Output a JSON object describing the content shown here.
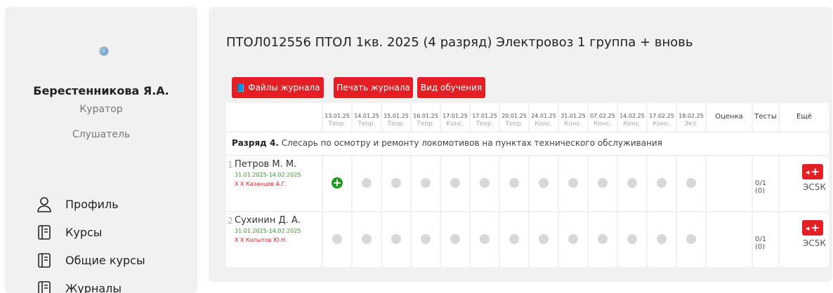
{
  "sidebar": {
    "user_name": "Берестенникова Я.А.",
    "roles": [
      "Куратор",
      "Слушатель"
    ],
    "nav": [
      {
        "label": "Профиль",
        "icon": "user-icon"
      },
      {
        "label": "Курсы",
        "icon": "book-icon"
      },
      {
        "label": "Общие курсы",
        "icon": "book-icon"
      },
      {
        "label": "Журналы",
        "icon": "book-icon"
      }
    ]
  },
  "main": {
    "title": "ПТОЛ012556  ПТОЛ 1кв. 2025 (4 разряд) Электровоз 1 группа + вновь",
    "buttons": {
      "files": "Файлы журнала",
      "print": "Печать журнала",
      "training_type": "Вид обучения"
    }
  },
  "table": {
    "columns": [
      {
        "date": "13.01.25",
        "type": "Теор."
      },
      {
        "date": "14.01.25",
        "type": "Теор."
      },
      {
        "date": "15.01.25",
        "type": "Теор."
      },
      {
        "date": "16.01.25",
        "type": "Теор."
      },
      {
        "date": "17.01.25",
        "type": "Конс."
      },
      {
        "date": "17.01.25",
        "type": "Теор."
      },
      {
        "date": "20.01.25",
        "type": "Теор."
      },
      {
        "date": "24.01.25",
        "type": "Конс."
      },
      {
        "date": "31.01.25",
        "type": "Конс."
      },
      {
        "date": "07.02.25",
        "type": "Конс."
      },
      {
        "date": "14.02.25",
        "type": "Конс."
      },
      {
        "date": "17.02.25",
        "type": "Конс."
      },
      {
        "date": "18.02.25",
        "type": "Экз."
      }
    ],
    "headers": {
      "grade": "Оценка",
      "tests": "Тесты",
      "more": "Ещё"
    },
    "rank": {
      "bold": "Разряд 4.",
      "text": " Слесарь по осмотру и ремонту локомотивов на пунктах технического обслуживания"
    },
    "students": [
      {
        "num": "1",
        "name": "Петров М. М.",
        "dates": "31.01.2025-14.02.2025",
        "teacher": "Х Х Казанцев А.Г.",
        "tests": "0/1 (0)",
        "more_label": "ЭС5К",
        "marks": [
          "add",
          "",
          "",
          "",
          "",
          "",
          "",
          "",
          "",
          "",
          "",
          "",
          ""
        ]
      },
      {
        "num": "2",
        "name": "Сухинин Д. А.",
        "dates": "31.01.2025-14.02.2025",
        "teacher": "Х Х Копытов Ю.Н.",
        "tests": "0/1 (0)",
        "more_label": "ЭС5К",
        "marks": [
          "",
          "",
          "",
          "",
          "",
          "",
          "",
          "",
          "",
          "",
          "",
          "",
          ""
        ]
      }
    ]
  },
  "colors": {
    "accent": "#e31e24",
    "panel": "#f1f1f1",
    "green": "#1a9e1a"
  }
}
